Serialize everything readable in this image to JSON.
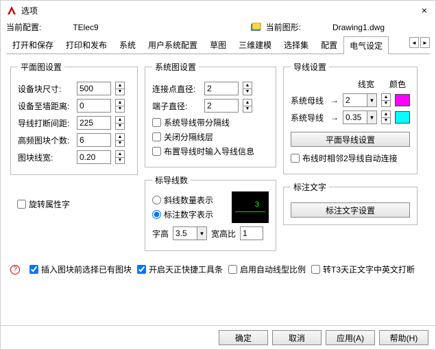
{
  "window": {
    "title": "选项",
    "close": "×"
  },
  "profile": {
    "label": "当前配置:",
    "value": "TElec9",
    "drawing_label": "当前图形:",
    "drawing": "Drawing1.dwg"
  },
  "tabs": {
    "items": [
      "打开和保存",
      "打印和发布",
      "系统",
      "用户系统配置",
      "草图",
      "三维建模",
      "选择集",
      "配置",
      "电气设定"
    ],
    "active": 8
  },
  "left": {
    "legend": "平面图设置",
    "rows": [
      {
        "label": "设备块尺寸:",
        "value": "500"
      },
      {
        "label": "设备至墙距离:",
        "value": "0"
      },
      {
        "label": "导线打断间距:",
        "value": "225"
      },
      {
        "label": "高频图块个数:",
        "value": "6"
      },
      {
        "label": "图块线宽:",
        "value": "0.20"
      }
    ],
    "rotate": "旋转属性字"
  },
  "mid": {
    "sys": {
      "legend": "系统图设置",
      "rows": [
        {
          "label": "连接点直径:",
          "value": "2"
        },
        {
          "label": "端子直径:",
          "value": "2"
        }
      ],
      "checks": [
        "系统导线带分隔线",
        "关闭分隔线层",
        "布置导线时输入导线信息"
      ]
    },
    "mark": {
      "legend": "标导线数",
      "radios": [
        "斜线数量表示",
        "标注数字表示"
      ],
      "active": 1,
      "h_label": "字高",
      "h_val": "3.5",
      "r_label": "宽高比",
      "r_val": "1"
    }
  },
  "right": {
    "wire": {
      "legend": "导线设置",
      "cols": [
        "线宽",
        "颜色"
      ],
      "rows": [
        {
          "label": "系统母线",
          "val": "2",
          "color": "#ff00ff"
        },
        {
          "label": "系统导线",
          "val": "0.35",
          "color": "#00ffff"
        }
      ],
      "btn": "平面导线设置",
      "auto": "布线时相邻2导线自动连接"
    },
    "text": {
      "legend": "标注文字",
      "btn": "标注文字设置"
    }
  },
  "footer": {
    "checks": [
      {
        "label": "插入图块前选择已有图块",
        "checked": true
      },
      {
        "label": "开启天正快捷工具条",
        "checked": true
      },
      {
        "label": "启用自动线型比例",
        "checked": false
      },
      {
        "label": "转T3天正文字中英文打断",
        "checked": false
      }
    ]
  },
  "buttons": {
    "ok": "确定",
    "cancel": "取消",
    "apply": "应用(A)",
    "help": "帮助(H)"
  }
}
